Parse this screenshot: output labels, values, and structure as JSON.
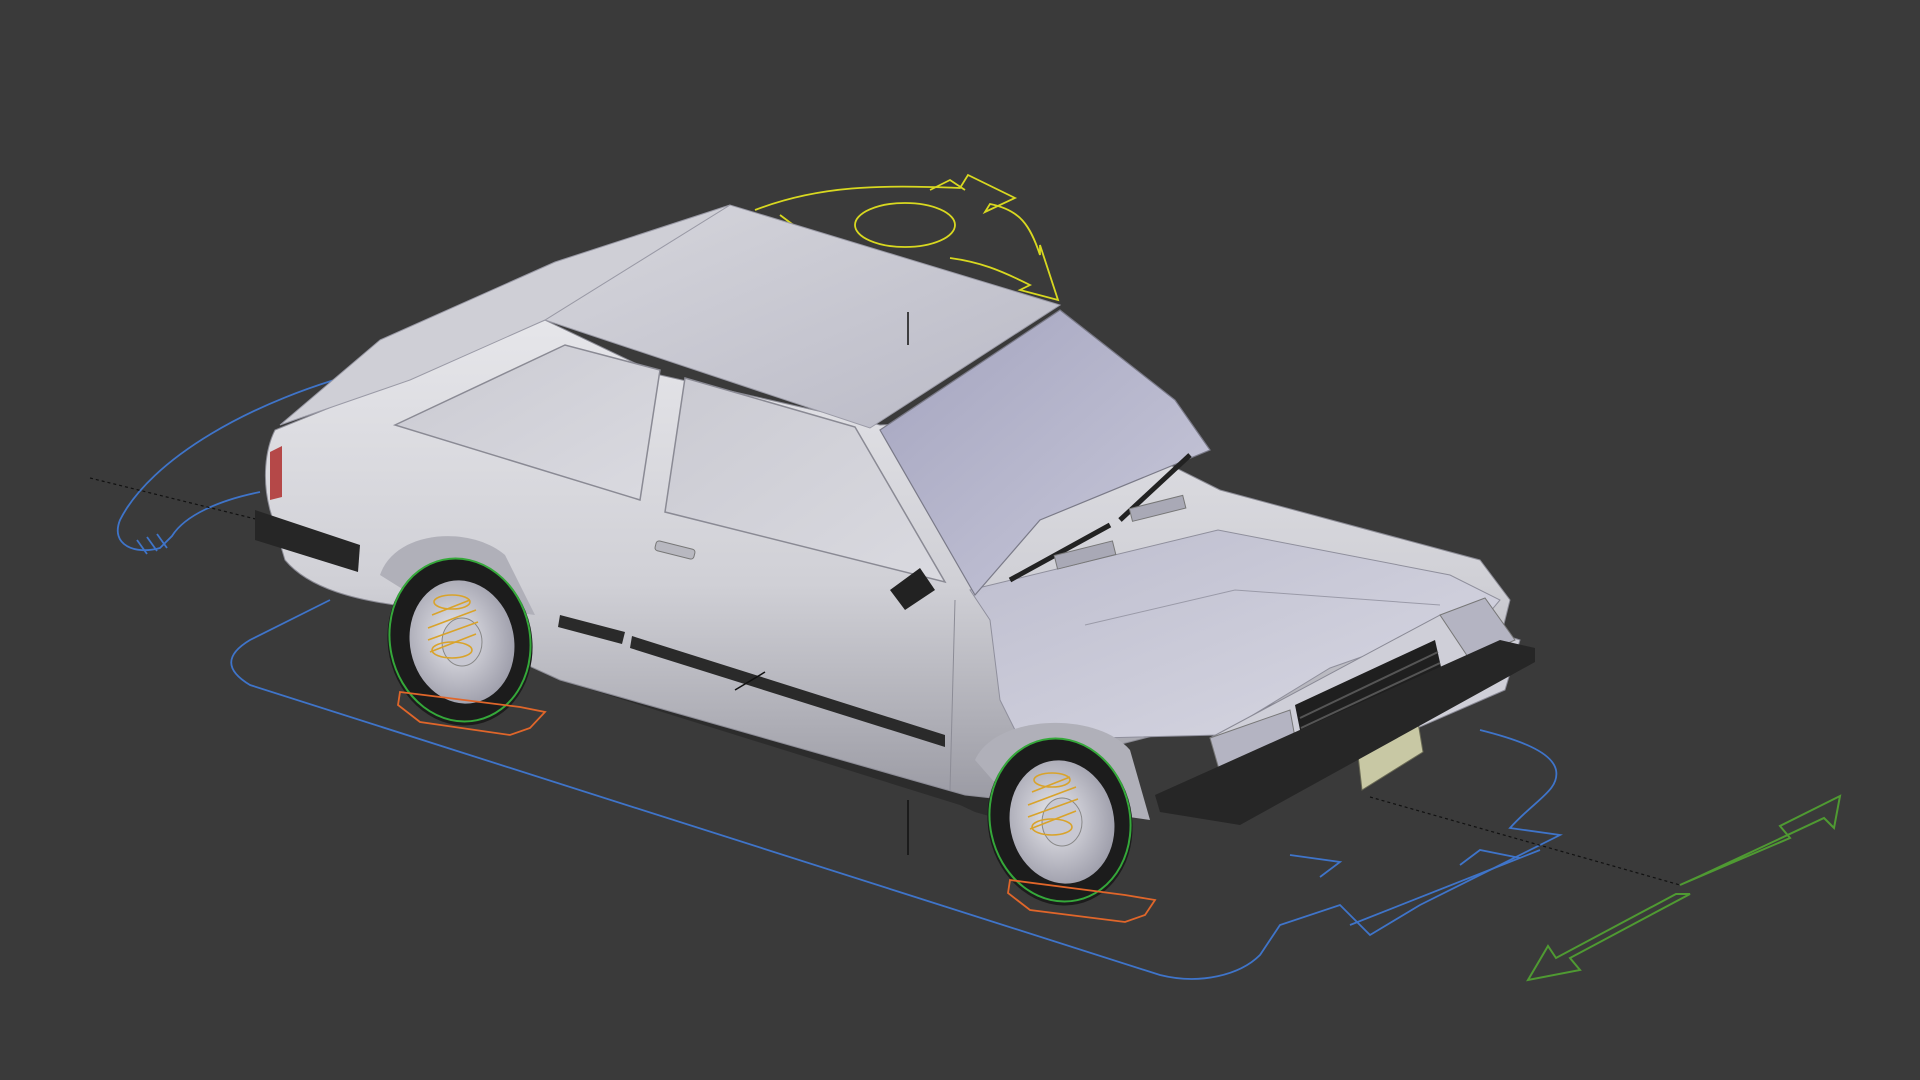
{
  "viewport": {
    "background": "#3a3a3a",
    "object": "car-model",
    "body_color": "#c9cad3",
    "colors": {
      "root_control": "#3f74c9",
      "move_control": "#d8d820",
      "direction_control": "#4f9a32",
      "wheel_control": "#35a83a",
      "suspension_spring": "#d9a32a",
      "contact_pad": "#e0662a"
    },
    "icons": [
      "rotate-gizmo-icon",
      "direction-arrow-icon"
    ]
  }
}
